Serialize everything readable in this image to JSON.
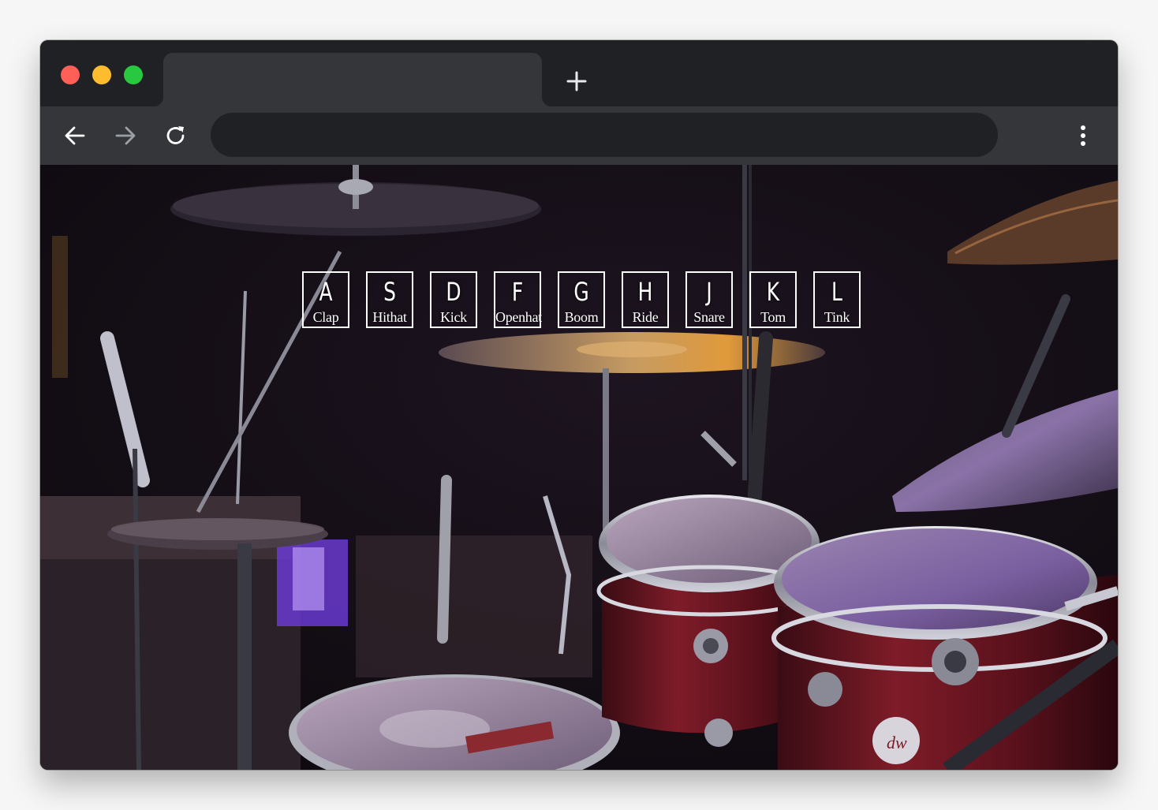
{
  "browser": {
    "tab_title": "",
    "new_tab_icon": "plus-icon",
    "address": "",
    "colors": {
      "close": "#fe5f57",
      "minimize": "#febc2e",
      "maximize": "#28c840",
      "frame": "#202124",
      "toolbar": "#35363a"
    }
  },
  "toolbar": {
    "back_icon": "arrow-left-icon",
    "forward_icon": "arrow-right-icon",
    "reload_icon": "reload-icon",
    "menu_icon": "kebab-menu-icon"
  },
  "page": {
    "background": "drum-kit-photo",
    "keys": [
      {
        "key": "A",
        "sound": "Clap"
      },
      {
        "key": "S",
        "sound": "Hithat"
      },
      {
        "key": "D",
        "sound": "Kick"
      },
      {
        "key": "F",
        "sound": "Openhat"
      },
      {
        "key": "G",
        "sound": "Boom"
      },
      {
        "key": "H",
        "sound": "Ride"
      },
      {
        "key": "J",
        "sound": "Snare"
      },
      {
        "key": "K",
        "sound": "Tom"
      },
      {
        "key": "L",
        "sound": "Tink"
      }
    ]
  }
}
